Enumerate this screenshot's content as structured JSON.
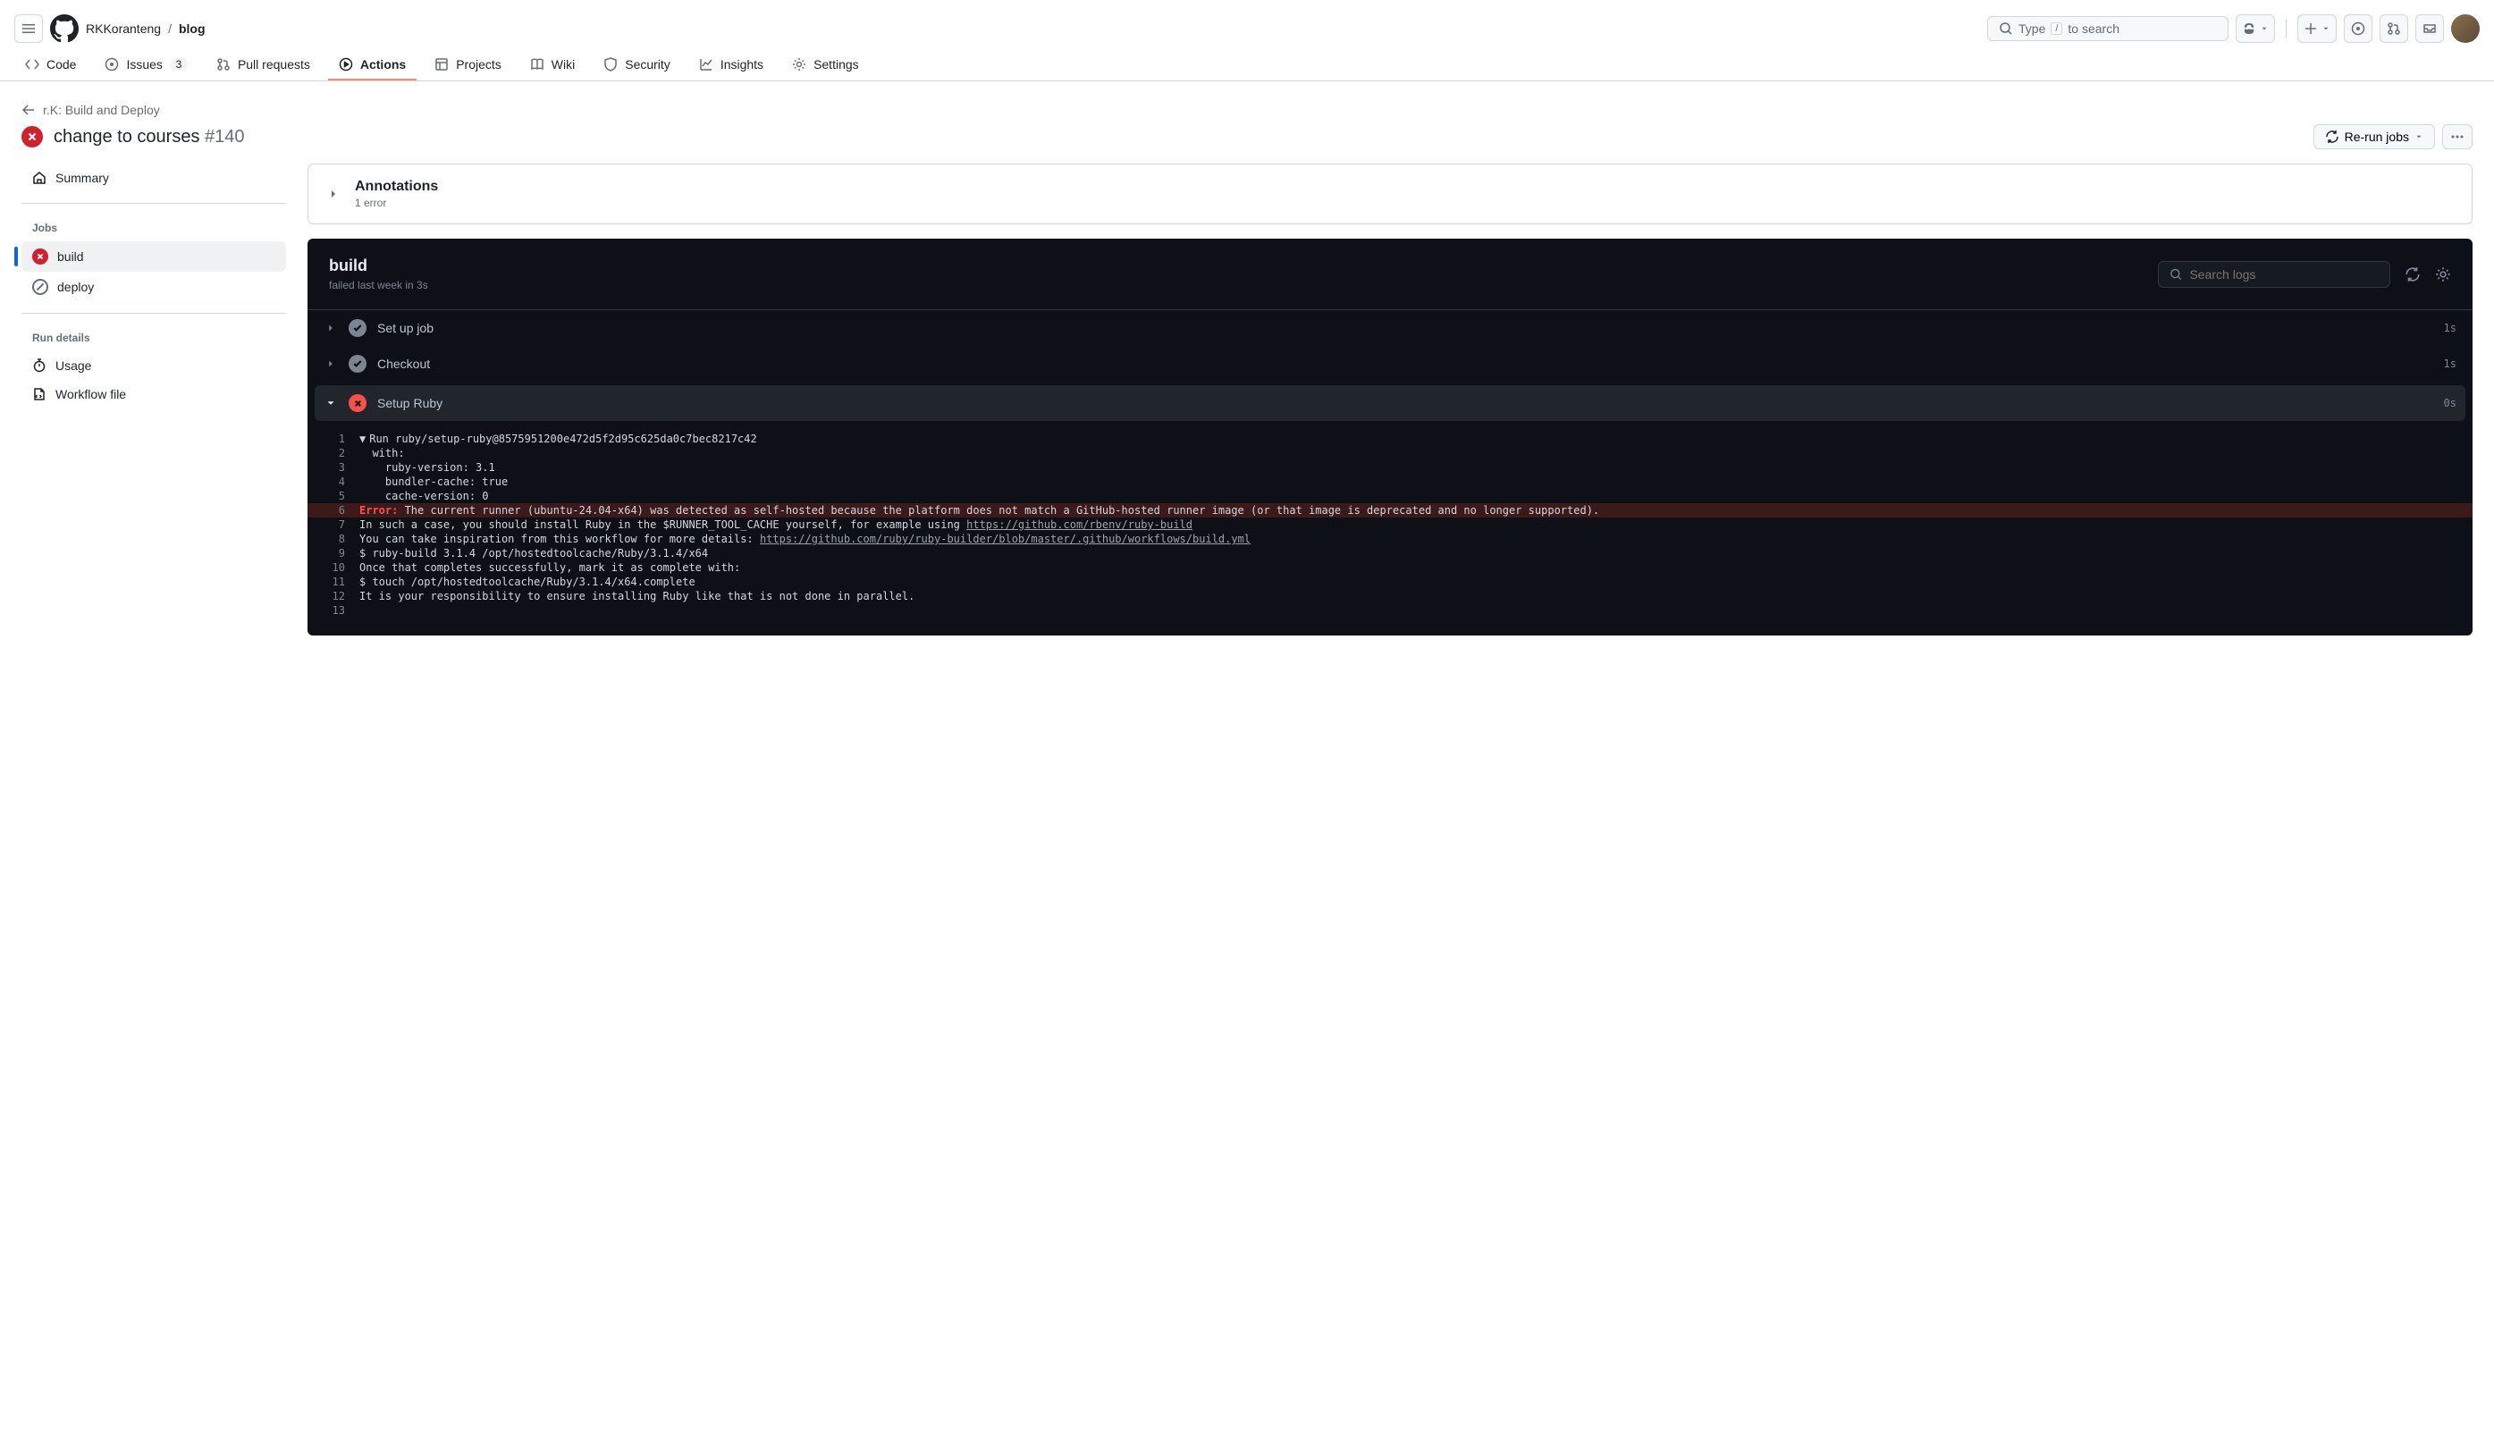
{
  "header": {
    "owner": "RKKoranteng",
    "repo": "blog",
    "search_prefix": "Type",
    "search_key": "/",
    "search_suffix": "to search"
  },
  "repoNav": {
    "code": "Code",
    "issues": "Issues",
    "issues_count": "3",
    "pulls": "Pull requests",
    "actions": "Actions",
    "projects": "Projects",
    "wiki": "Wiki",
    "security": "Security",
    "insights": "Insights",
    "settings": "Settings"
  },
  "run": {
    "back_label": "r.K: Build and Deploy",
    "title": "change to courses",
    "number": "#140",
    "rerun_label": "Re-run jobs"
  },
  "sidebar": {
    "summary": "Summary",
    "jobs_heading": "Jobs",
    "jobs": [
      {
        "name": "build",
        "status": "fail"
      },
      {
        "name": "deploy",
        "status": "skip"
      }
    ],
    "run_details_heading": "Run details",
    "usage": "Usage",
    "workflow_file": "Workflow file"
  },
  "annotations": {
    "title": "Annotations",
    "subtitle": "1 error"
  },
  "job": {
    "name": "build",
    "status_line": "failed last week in 3s",
    "search_placeholder": "Search logs"
  },
  "steps": [
    {
      "name": "Set up job",
      "status": "ok",
      "time": "1s",
      "expanded": false
    },
    {
      "name": "Checkout",
      "status": "ok",
      "time": "1s",
      "expanded": false
    },
    {
      "name": "Setup Ruby",
      "status": "fail",
      "time": "0s",
      "expanded": true
    }
  ],
  "log": [
    {
      "n": 1,
      "caret": true,
      "text": "Run ruby/setup-ruby@8575951200e472d5f2d95c625da0c7bec8217c42"
    },
    {
      "n": 2,
      "text": "  with:"
    },
    {
      "n": 3,
      "text": "    ruby-version: 3.1"
    },
    {
      "n": 4,
      "text": "    bundler-cache: true"
    },
    {
      "n": 5,
      "text": "    cache-version: 0"
    },
    {
      "n": 6,
      "err": true,
      "err_label": "Error:",
      "text": " The current runner (ubuntu-24.04-x64) was detected as self-hosted because the platform does not match a GitHub-hosted runner image (or that image is deprecated and no longer supported)."
    },
    {
      "n": 7,
      "text": "In such a case, you should install Ruby in the $RUNNER_TOOL_CACHE yourself, for example using ",
      "link": "https://github.com/rbenv/ruby-build"
    },
    {
      "n": 8,
      "text": "You can take inspiration from this workflow for more details: ",
      "link": "https://github.com/ruby/ruby-builder/blob/master/.github/workflows/build.yml"
    },
    {
      "n": 9,
      "text": "$ ruby-build 3.1.4 /opt/hostedtoolcache/Ruby/3.1.4/x64"
    },
    {
      "n": 10,
      "text": "Once that completes successfully, mark it as complete with:"
    },
    {
      "n": 11,
      "text": "$ touch /opt/hostedtoolcache/Ruby/3.1.4/x64.complete"
    },
    {
      "n": 12,
      "text": "It is your responsibility to ensure installing Ruby like that is not done in parallel."
    },
    {
      "n": 13,
      "text": ""
    }
  ]
}
